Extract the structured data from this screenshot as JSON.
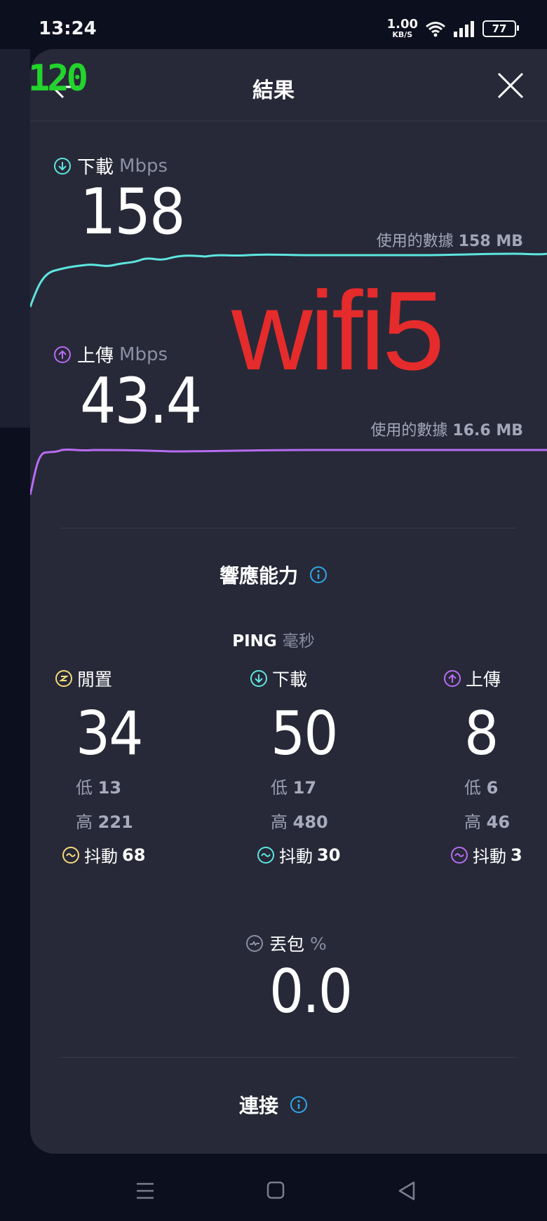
{
  "status_bar": {
    "time": "13:24",
    "net_speed_value": "1.00",
    "net_speed_unit": "KB/S",
    "battery": "77"
  },
  "overlay_badge": "120",
  "header": {
    "title": "結果"
  },
  "download": {
    "label": "下載",
    "unit": "Mbps",
    "value": "158",
    "data_used_label": "使用的數據",
    "data_used_value": "158 MB"
  },
  "upload": {
    "label": "上傳",
    "unit": "Mbps",
    "value": "43.4",
    "data_used_label": "使用的數據",
    "data_used_value": "16.6 MB"
  },
  "overlay_text": "wifi5",
  "responsiveness": {
    "title": "響應能力",
    "ping_label": "PING",
    "ping_unit": "毫秒",
    "columns": [
      {
        "label": "閒置",
        "value": "34",
        "low_label": "低",
        "low": "13",
        "high_label": "高",
        "high": "221",
        "jitter_label": "抖動",
        "jitter": "68"
      },
      {
        "label": "下載",
        "value": "50",
        "low_label": "低",
        "low": "17",
        "high_label": "高",
        "high": "480",
        "jitter_label": "抖動",
        "jitter": "30"
      },
      {
        "label": "上傳",
        "value": "8",
        "low_label": "低",
        "low": "6",
        "high_label": "高",
        "high": "46",
        "jitter_label": "抖動",
        "jitter": "3"
      }
    ],
    "packet_loss_label": "丟包",
    "packet_loss_unit": "%",
    "packet_loss_value": "0.0"
  },
  "connection": {
    "title": "連接"
  },
  "colors": {
    "download_accent": "#5ee6e0",
    "upload_accent": "#b86cf2",
    "idle_accent": "#f5dc7a",
    "info_accent": "#2fa8e8",
    "overlay_red": "#e52b2b",
    "overlay_green": "#22d42c"
  },
  "icons": {
    "back": "arrow-left-icon",
    "close": "close-icon",
    "download": "arrow-down-circle-icon",
    "upload": "arrow-up-circle-icon",
    "idle": "idle-circle-icon",
    "jitter": "wave-circle-icon",
    "info": "info-circle-icon",
    "packet_loss": "gauge-icon"
  }
}
